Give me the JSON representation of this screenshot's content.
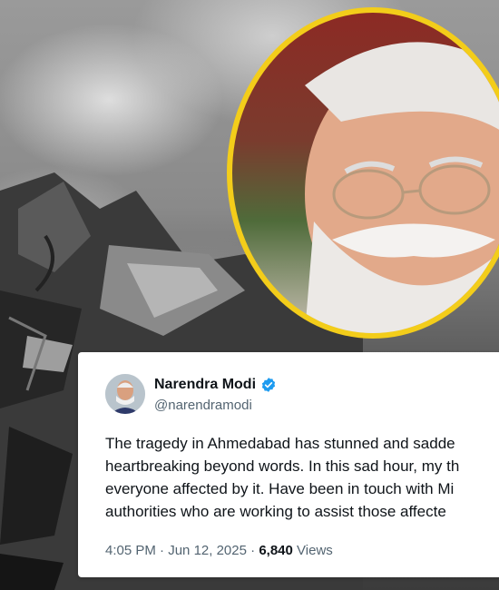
{
  "post": {
    "author_name": "Narendra Modi",
    "handle": "@narendramodi",
    "text_lines": [
      "The tragedy in Ahmedabad has stunned and sadde",
      "heartbreaking beyond words. In this sad hour, my th",
      "everyone affected by it. Have been in touch with Mi",
      "authorities who are working to assist those affecte"
    ],
    "time": "4:05 PM",
    "date": "Jun 12, 2025",
    "separator": "·",
    "views_count": "6,840",
    "views_label": "Views"
  },
  "colors": {
    "portrait_border": "#f3cd1a",
    "verified_badge": "#1d9bf0"
  },
  "icons": {
    "verified": "verified-badge-icon"
  }
}
